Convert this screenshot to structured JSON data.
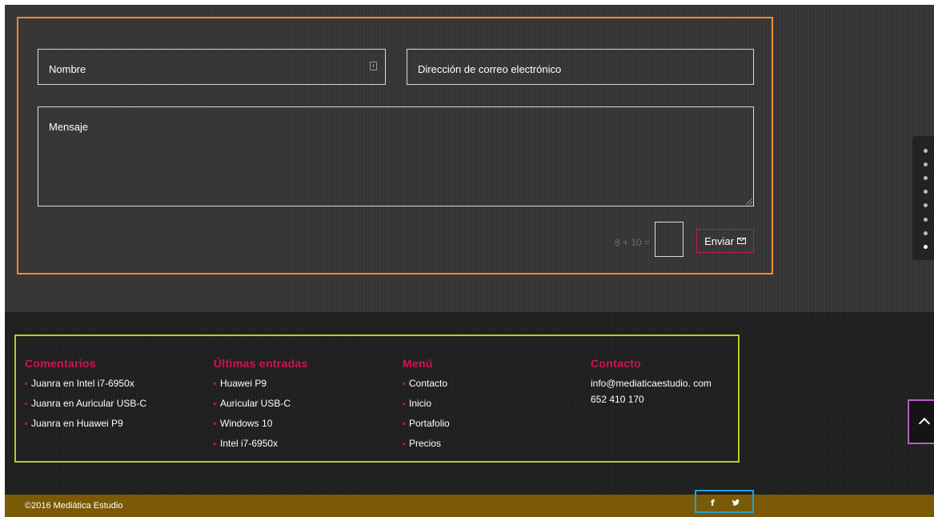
{
  "contact_form": {
    "name_placeholder": "Nombre",
    "email_placeholder": "Dirección de correo electrónico",
    "message_placeholder": "Mensaje",
    "captcha_question": "8 + 10 =",
    "send_label": "Enviar"
  },
  "section_nav": {
    "dots": 8,
    "active_index": 7
  },
  "footer": {
    "comments": {
      "title": "Comentarios",
      "items": [
        "Juanra en Intel i7-6950x",
        "Juanra en Auricular USB-C",
        "Juanra en Huawei P9"
      ]
    },
    "latest_posts": {
      "title": "Últimas entradas",
      "items": [
        "Huawei P9",
        "Auricular USB-C",
        "Windows 10",
        "Intel i7-6950x"
      ]
    },
    "menu": {
      "title": "Menú",
      "items": [
        "Contacto",
        "Inicio",
        "Portafolio",
        "Precios"
      ]
    },
    "contact": {
      "title": "Contacto",
      "email": "info@mediaticaestudio. com",
      "phone": "652 410 170"
    }
  },
  "bottom_bar": {
    "copyright": "©2016 Mediática Estudio",
    "facebook_glyph": "f"
  },
  "colors": {
    "accent": "#d0144f",
    "bottom_bar": "#7a5a06",
    "form_frame": "#ef8b2e",
    "footer_frame": "#a7d32e",
    "social_frame": "#1fa2d9",
    "top_frame": "#b65fc1"
  },
  "icons": [
    "autofill-icon",
    "resize-grip-icon",
    "mail-icon",
    "chevron-up-icon",
    "facebook-icon",
    "twitter-icon"
  ]
}
